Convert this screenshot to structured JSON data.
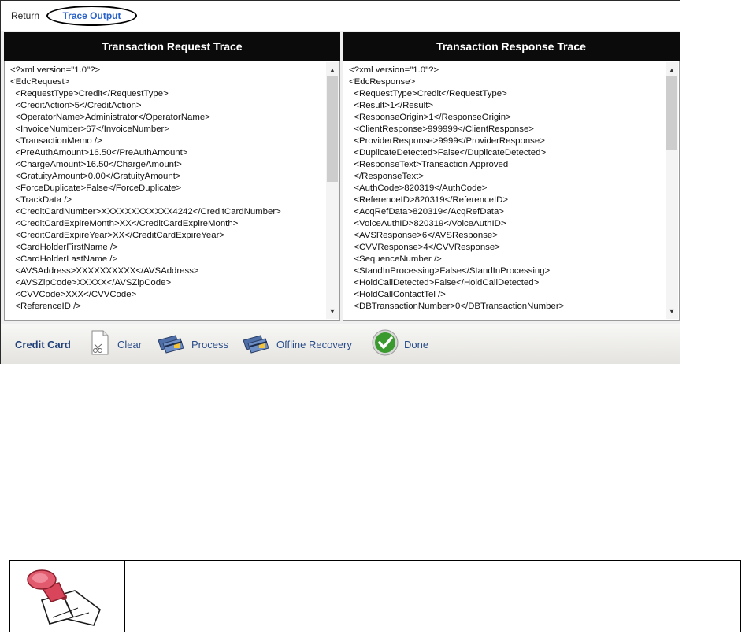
{
  "tabs": {
    "return": "Return",
    "trace_output": "Trace Output"
  },
  "request": {
    "title": "Transaction Request Trace",
    "lines": [
      "<?xml version=\"1.0\"?>",
      "<EdcRequest>",
      "  <RequestType>Credit</RequestType>",
      "  <CreditAction>5</CreditAction>",
      "  <OperatorName>Administrator</OperatorName>",
      "  <InvoiceNumber>67</InvoiceNumber>",
      "  <TransactionMemo />",
      "  <PreAuthAmount>16.50</PreAuthAmount>",
      "  <ChargeAmount>16.50</ChargeAmount>",
      "  <GratuityAmount>0.00</GratuityAmount>",
      "  <ForceDuplicate>False</ForceDuplicate>",
      "  <TrackData />",
      "  <CreditCardNumber>XXXXXXXXXXXX4242</CreditCardNumber>",
      "  <CreditCardExpireMonth>XX</CreditCardExpireMonth>",
      "  <CreditCardExpireYear>XX</CreditCardExpireYear>",
      "  <CardHolderFirstName />",
      "  <CardHolderLastName />",
      "  <AVSAddress>XXXXXXXXXX</AVSAddress>",
      "  <AVSZipCode>XXXXX</AVSZipCode>",
      "  <CVVCode>XXX</CVVCode>",
      "  <ReferenceID />"
    ],
    "scroll_position": 0.0
  },
  "response": {
    "title": "Transaction Response Trace",
    "lines": [
      "<?xml version=\"1.0\"?>",
      "<EdcResponse>",
      "  <RequestType>Credit</RequestType>",
      "  <Result>1</Result>",
      "  <ResponseOrigin>1</ResponseOrigin>",
      "  <ClientResponse>999999</ClientResponse>",
      "  <ProviderResponse>9999</ProviderResponse>",
      "  <DuplicateDetected>False</DuplicateDetected>",
      "  <ResponseText>Transaction Approved",
      "  </ResponseText>",
      "  <AuthCode>820319</AuthCode>",
      "  <ReferenceID>820319</ReferenceID>",
      "  <AcqRefData>820319</AcqRefData>",
      "  <VoiceAuthID>820319</VoiceAuthID>",
      "  <AVSResponse>6</AVSResponse>",
      "  <CVVResponse>4</CVVResponse>",
      "  <SequenceNumber />",
      "  <StandInProcessing>False</StandInProcessing>",
      "  <HoldCallDetected>False</HoldCallDetected>",
      "  <HoldCallContactTel />",
      "  <DBTransactionNumber>0</DBTransactionNumber>"
    ],
    "scroll_position": 0.0
  },
  "toolbar": {
    "title": "Credit Card",
    "clear": "Clear",
    "process": "Process",
    "offline_recovery": "Offline Recovery",
    "done": "Done"
  },
  "colors": {
    "header_bg": "#0b0b0b",
    "tab_active": "#2a62c9",
    "toolbar_text": "#2a4d8a",
    "done_green": "#3a9a2e"
  }
}
